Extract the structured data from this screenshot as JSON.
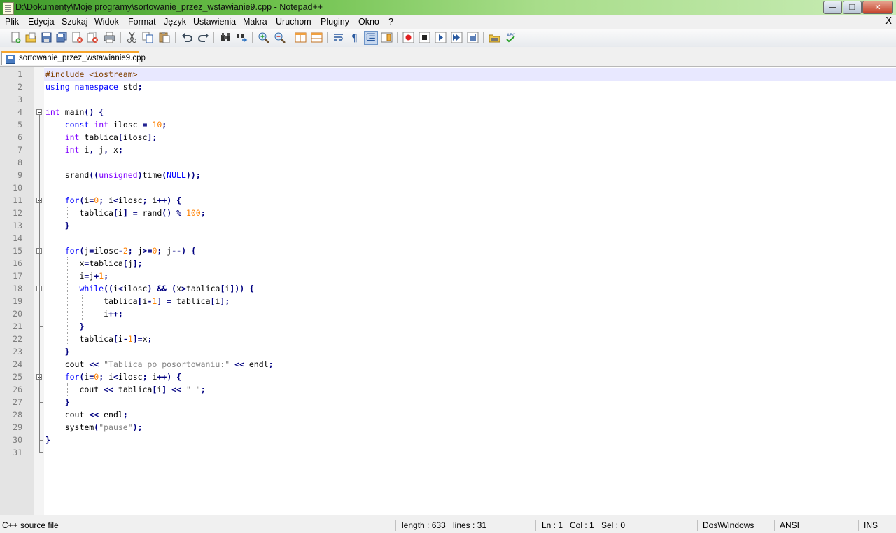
{
  "window": {
    "title": "D:\\Dokumenty\\Moje programy\\sortowanie_przez_wstawianie9.cpp - Notepad++",
    "minimize": "—",
    "maximize": "❐",
    "close": "✕"
  },
  "menu": {
    "items": [
      "Plik",
      "Edycja",
      "Szukaj",
      "Widok",
      "Format",
      "Język",
      "Ustawienia",
      "Makra",
      "Uruchom",
      "Pluginy",
      "Okno",
      "?"
    ],
    "close_doc": "X"
  },
  "toolbar": {
    "icons": [
      "new-file-icon",
      "open-file-icon",
      "save-icon",
      "save-all-icon",
      "close-icon",
      "close-all-icon",
      "print-icon",
      "cut-icon",
      "copy-icon",
      "paste-icon",
      "undo-icon",
      "redo-icon",
      "find-icon",
      "replace-icon",
      "zoom-in-icon",
      "zoom-out-icon",
      "sync-vertical-icon",
      "sync-horizontal-icon",
      "word-wrap-icon",
      "show-all-chars-icon",
      "indent-guide-icon",
      "doc-map-icon",
      "record-macro-icon",
      "stop-macro-icon",
      "play-macro-icon",
      "run-macro-multiple-icon",
      "save-macro-icon",
      "open-folder-icon",
      "spellcheck-icon"
    ]
  },
  "tabs": [
    {
      "label": "sortowanie_przez_wstawianie9.cpp",
      "active": true
    }
  ],
  "editor": {
    "current_line": 1,
    "lines": [
      "#include <iostream>",
      "using namespace std;",
      "",
      "int main() {",
      "    const int ilosc = 10;",
      "    int tablica[ilosc];",
      "    int i, j, x;",
      "",
      "    srand((unsigned)time(NULL));",
      "",
      "    for(i=0; i<ilosc; i++) {",
      "       tablica[i] = rand() % 100;",
      "    }",
      "",
      "    for(j=ilosc-2; j>=0; j--) {",
      "       x=tablica[j];",
      "       i=j+1;",
      "       while((i<ilosc) && (x>tablica[i])) {",
      "            tablica[i-1] = tablica[i];",
      "            i++;",
      "       }",
      "       tablica[i-1]=x;",
      "    }",
      "    cout << \"Tablica po posortowaniu:\" << endl;",
      "    for(i=0; i<ilosc; i++) {",
      "       cout << tablica[i] << \" \";",
      "    }",
      "    cout << endl;",
      "    system(\"pause\");",
      "}",
      ""
    ]
  },
  "status": {
    "file_type": "C++ source file",
    "length": "length : 633",
    "lines": "lines : 31",
    "ln": "Ln : 1",
    "col": "Col : 1",
    "sel": "Sel : 0",
    "eol": "Dos\\Windows",
    "encoding": "ANSI",
    "mode": "INS"
  }
}
